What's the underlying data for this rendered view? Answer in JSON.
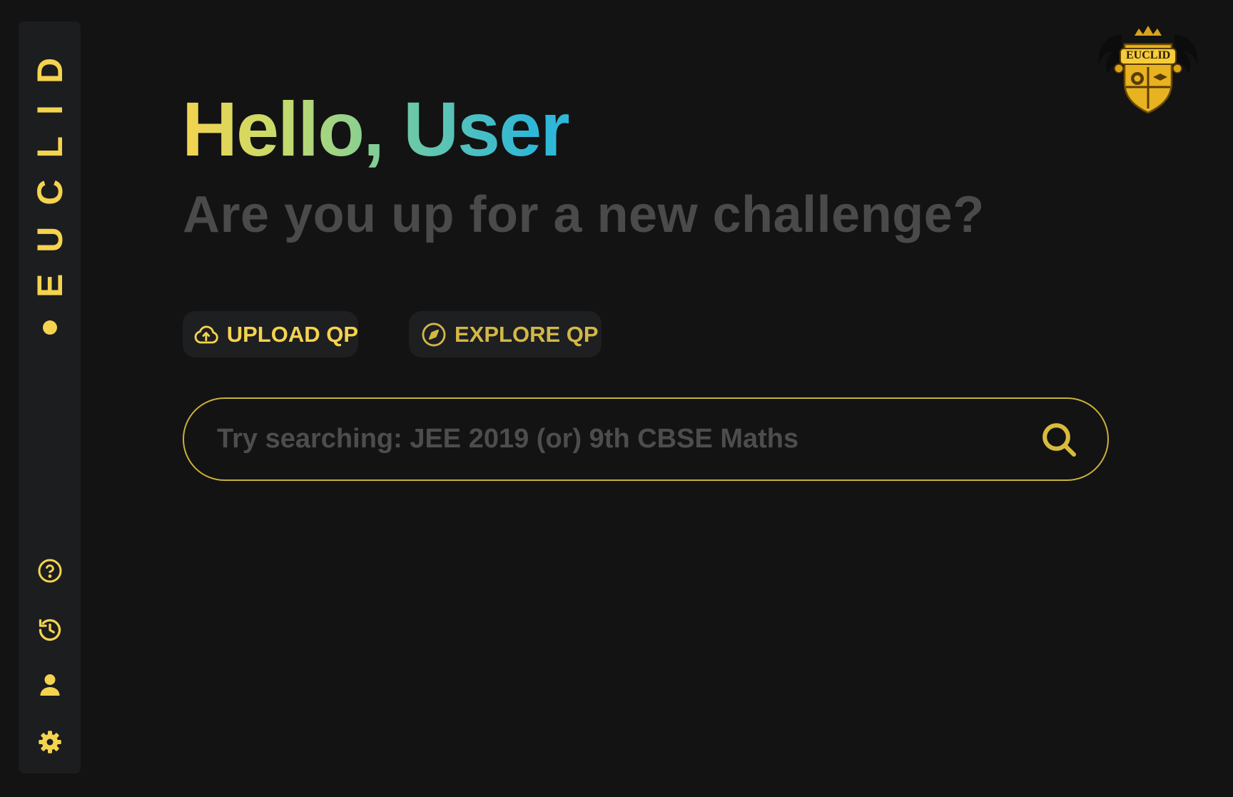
{
  "sidebar": {
    "brand": "EUCLID",
    "icons": {
      "help": "help-circle-icon",
      "history": "history-icon",
      "profile": "user-icon",
      "settings": "gear-icon"
    }
  },
  "logo": {
    "text": "EUCLID"
  },
  "hero": {
    "greeting_hello": "Hello,",
    "greeting_name": "User",
    "subtitle": "Are you up for a new challenge?"
  },
  "actions": {
    "upload_label": "UPLOAD QP",
    "explore_label": "EXPLORE QP"
  },
  "search": {
    "placeholder": "Try searching: JEE 2019 (or) 9th CBSE Maths",
    "value": ""
  },
  "colors": {
    "background": "#131313",
    "sidebar": "#1c1d1f",
    "accent": "#f4d34f",
    "muted_text": "#4a4a4a",
    "gradient_end": "#2fb7d8"
  }
}
